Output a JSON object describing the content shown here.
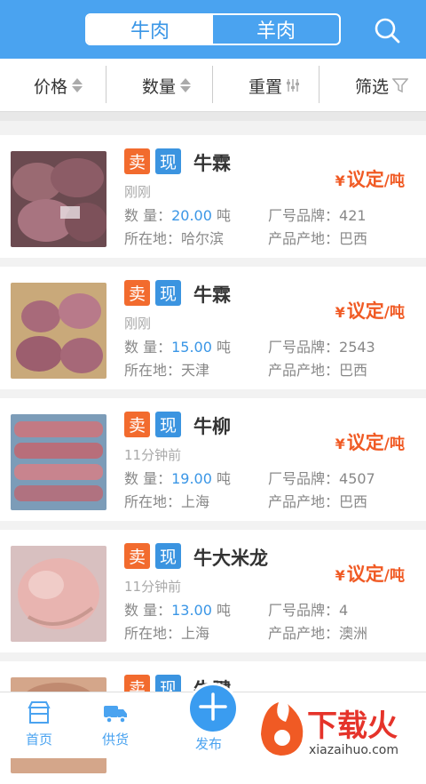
{
  "header": {
    "tabs": [
      {
        "label": "牛肉",
        "active": true
      },
      {
        "label": "羊肉",
        "active": false
      }
    ],
    "search_icon": "search-icon"
  },
  "filters": [
    {
      "label": "价格",
      "icon": "sort-icon"
    },
    {
      "label": "数量",
      "icon": "sort-icon"
    },
    {
      "label": "重置",
      "icon": "reset-icon"
    },
    {
      "label": "筛选",
      "icon": "filter-icon"
    }
  ],
  "listing_labels": {
    "sell_tag": "卖",
    "stock_tag": "现",
    "qty_label": "数 量：",
    "location_label": "所在地：",
    "brand_label": "厂号品牌：",
    "origin_label": "产品产地：",
    "price_symbol": "¥",
    "price_text": "议定",
    "price_unit": "/吨"
  },
  "listings": [
    {
      "name": "牛霖",
      "time": "刚刚",
      "qty": "20.00",
      "qty_unit": "吨",
      "location": "哈尔滨",
      "brand": "421",
      "origin": "巴西"
    },
    {
      "name": "牛霖",
      "time": "刚刚",
      "qty": "15.00",
      "qty_unit": "吨",
      "location": "天津",
      "brand": "2543",
      "origin": "巴西"
    },
    {
      "name": "牛柳",
      "time": "11分钟前",
      "qty": "19.00",
      "qty_unit": "吨",
      "location": "上海",
      "brand": "4507",
      "origin": "巴西"
    },
    {
      "name": "牛大米龙",
      "time": "11分钟前",
      "qty": "13.00",
      "qty_unit": "吨",
      "location": "上海",
      "brand": "4",
      "origin": "澳洲"
    },
    {
      "name": "牛腱",
      "time": "",
      "qty": "",
      "qty_unit": "",
      "location": "",
      "brand": "",
      "origin": ""
    }
  ],
  "tabbar": {
    "home": "首页",
    "supply": "供货",
    "publish": "发布"
  },
  "watermark": {
    "text": "下载火",
    "url_text": "xiazaihuo.com"
  },
  "colors": {
    "primary": "#4aa3f0",
    "accent": "#f05a24",
    "sell_tag": "#f26b2e",
    "stock_tag": "#3b94e0"
  }
}
